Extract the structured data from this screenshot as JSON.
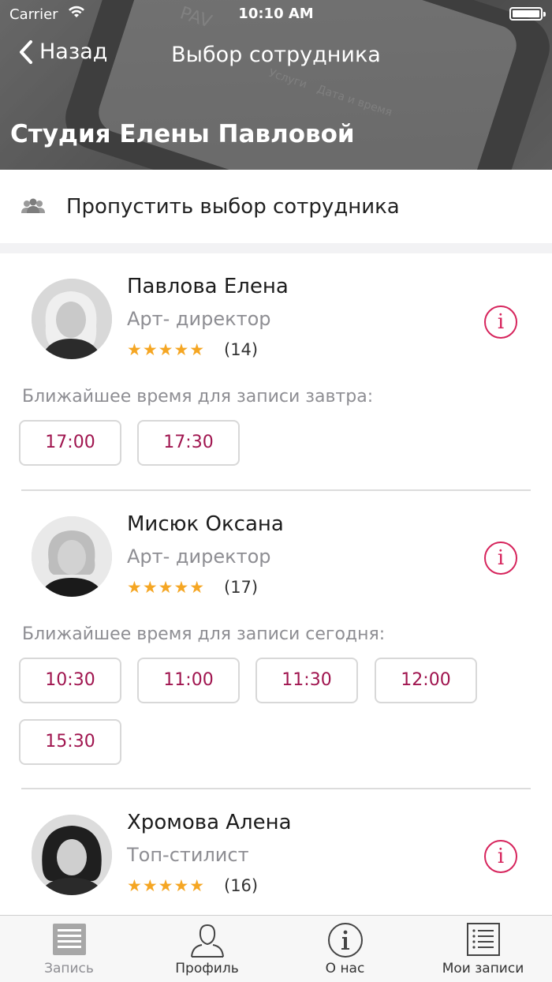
{
  "status_bar": {
    "carrier": "Carrier",
    "time": "10:10 AM"
  },
  "nav": {
    "back_label": "Назад",
    "title": "Выбор сотрудника"
  },
  "header": {
    "studio_name": "Студия Елены Павловой",
    "ghost_texts": [
      "PAV",
      "Услуги",
      "Дата и время"
    ]
  },
  "skip": {
    "label": "Пропустить выбор сотрудника",
    "icon": "group-icon"
  },
  "employees": [
    {
      "name": "Павлова Елена",
      "role": "Арт- директор",
      "rating": 5,
      "stars": "★★★★★",
      "reviews": "(14)",
      "nearest_label": "Ближайшее время для записи завтра:",
      "slots": [
        "17:00",
        "17:30"
      ]
    },
    {
      "name": "Мисюк Оксана",
      "role": "Арт- директор",
      "rating": 5,
      "stars": "★★★★★",
      "reviews": "(17)",
      "nearest_label": "Ближайшее время для записи сегодня:",
      "slots": [
        "10:30",
        "11:00",
        "11:30",
        "12:00",
        "15:30"
      ]
    },
    {
      "name": "Хромова Алена",
      "role": "Топ-стилист",
      "rating": 5,
      "stars": "★★★★★",
      "reviews": "(16)"
    }
  ],
  "info_glyph": "i",
  "tabbar": {
    "tabs": [
      {
        "label": "Запись",
        "icon": "booking-list-icon",
        "active": true
      },
      {
        "label": "Профиль",
        "icon": "profile-icon",
        "active": false
      },
      {
        "label": "О нас",
        "icon": "info-icon",
        "active": false
      },
      {
        "label": "Мои записи",
        "icon": "my-bookings-icon",
        "active": false
      }
    ]
  },
  "colors": {
    "accent": "#d6245c",
    "slot_text": "#a0154f",
    "star": "#f5a623"
  }
}
